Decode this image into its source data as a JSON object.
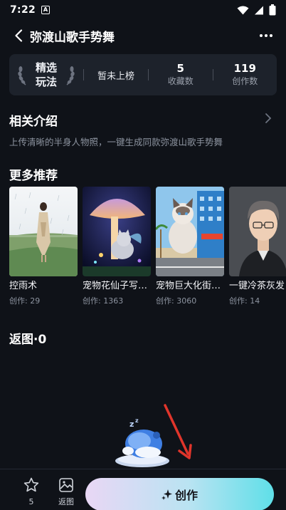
{
  "status_bar": {
    "time": "7:22",
    "notif_badge": "A"
  },
  "header": {
    "title": "弥渡山歌手势舞"
  },
  "stats": {
    "featured_line1": "精选",
    "featured_line2": "玩法",
    "rank_text": "暂未上榜",
    "favorites_value": "5",
    "favorites_label": "收藏数",
    "creations_value": "119",
    "creations_label": "创作数"
  },
  "intro": {
    "title": "相关介绍",
    "description": "上传清晰的半身人物照，一键生成同款弥渡山歌手势舞"
  },
  "recommendations": {
    "title": "更多推荐",
    "items": [
      {
        "name": "控雨术",
        "count": "创作: 29"
      },
      {
        "name": "宠物花仙子写…",
        "count": "创作: 1363"
      },
      {
        "name": "宠物巨大化街…",
        "count": "创作: 3060"
      },
      {
        "name": "一键冷茶灰发",
        "count": "创作: 14"
      }
    ]
  },
  "returns": {
    "title": "返图·0"
  },
  "bottom_bar": {
    "star_count": "5",
    "return_label": "返图",
    "create_label": "创作"
  },
  "colors": {
    "background": "#0f1218",
    "card": "#1d222b",
    "create_gradient_start": "#e9d7f5",
    "create_gradient_end": "#5fdfe8",
    "arrow": "#e0352b"
  }
}
